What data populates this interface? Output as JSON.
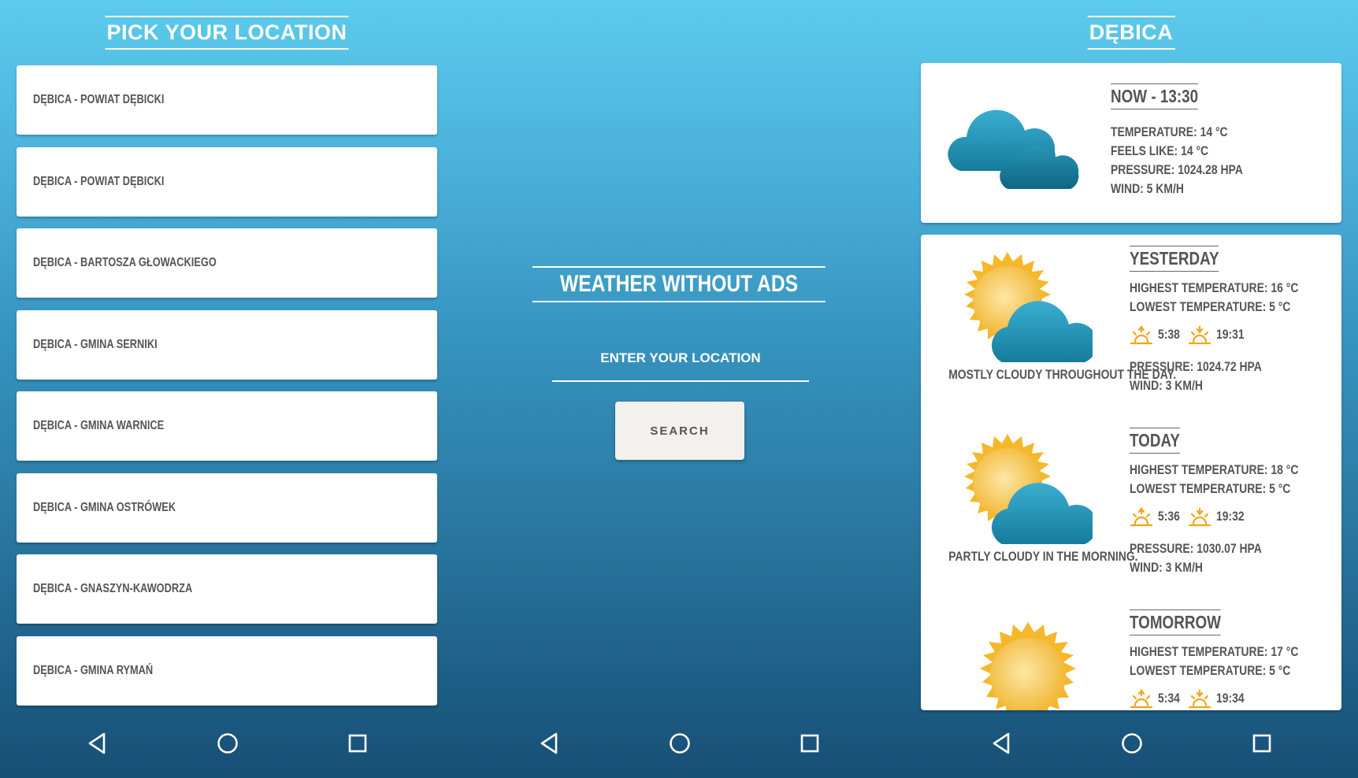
{
  "picker": {
    "title": "PICK YOUR LOCATION",
    "items": [
      {
        "label": "DĘBICA - POWIAT DĘBICKI"
      },
      {
        "label": "DĘBICA - POWIAT DĘBICKI"
      },
      {
        "label": "DĘBICA - BARTOSZA GŁOWACKIEGO"
      },
      {
        "label": "DĘBICA - GMINA SERNIKI"
      },
      {
        "label": "DĘBICA - GMINA WARNICE"
      },
      {
        "label": "DĘBICA - GMINA OSTRÓWEK"
      },
      {
        "label": "DĘBICA - GNASZYN-KAWODRZA"
      },
      {
        "label": "DĘBICA - GMINA RYMAŃ"
      }
    ]
  },
  "search": {
    "app_title": "WEATHER WITHOUT ADS",
    "placeholder": "ENTER YOUR LOCATION",
    "button_label": "SEARCH"
  },
  "weather": {
    "city": "DĘBICA",
    "now": {
      "heading": "NOW - 13:30",
      "temperature": "TEMPERATURE: 14 °C",
      "feels_like": "FEELS LIKE: 14 °C",
      "pressure": "PRESSURE: 1024.28 HPA",
      "wind": "WIND: 5 KM/H",
      "icon": "cloudy-icon"
    },
    "days": [
      {
        "heading": "YESTERDAY",
        "high": "HIGHEST TEMPERATURE: 16 °C",
        "low": "LOWEST TEMPERATURE: 5 °C",
        "sunrise": "5:38",
        "sunset": "19:31",
        "pressure": "PRESSURE: 1024.72 HPA",
        "wind": "WIND: 3 KM/H",
        "description": "MOSTLY CLOUDY THROUGHOUT THE DAY.",
        "icon": "partly-cloudy-icon"
      },
      {
        "heading": "TODAY",
        "high": "HIGHEST TEMPERATURE: 18 °C",
        "low": "LOWEST TEMPERATURE: 5 °C",
        "sunrise": "5:36",
        "sunset": "19:32",
        "pressure": "PRESSURE: 1030.07 HPA",
        "wind": "WIND: 3 KM/H",
        "description": "PARTLY CLOUDY IN THE MORNING.",
        "icon": "partly-cloudy-icon"
      },
      {
        "heading": "TOMORROW",
        "high": "HIGHEST TEMPERATURE: 17 °C",
        "low": "LOWEST TEMPERATURE: 5 °C",
        "sunrise": "5:34",
        "sunset": "19:34",
        "icon": "sun-icon"
      }
    ]
  },
  "colors": {
    "sun": "#f7c23c",
    "cloud": "#1f8fb0",
    "accent_orange": "#f2a516"
  },
  "nav_icons": [
    "back-icon",
    "home-icon",
    "recents-icon"
  ]
}
